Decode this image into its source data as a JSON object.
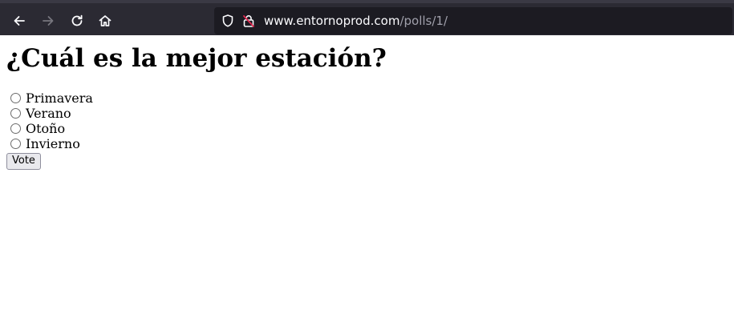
{
  "browser": {
    "url_host": "www.entornoprod.com",
    "url_path": "/polls/1/",
    "icons": {
      "back": "arrow-left-icon",
      "forward": "arrow-right-icon",
      "reload": "reload-icon",
      "home": "home-icon",
      "tracking": "shield-icon",
      "insecure": "insecure-lock-icon"
    }
  },
  "poll": {
    "question": "¿Cuál es la mejor estación?",
    "choices": [
      "Primavera",
      "Verano",
      "Otoño",
      "Invierno"
    ],
    "vote_label": "Vote"
  },
  "colors": {
    "toolbar_bg": "#2b2a33",
    "urlbar_bg": "#1c1b22",
    "insecure_accent": "#e22850"
  }
}
